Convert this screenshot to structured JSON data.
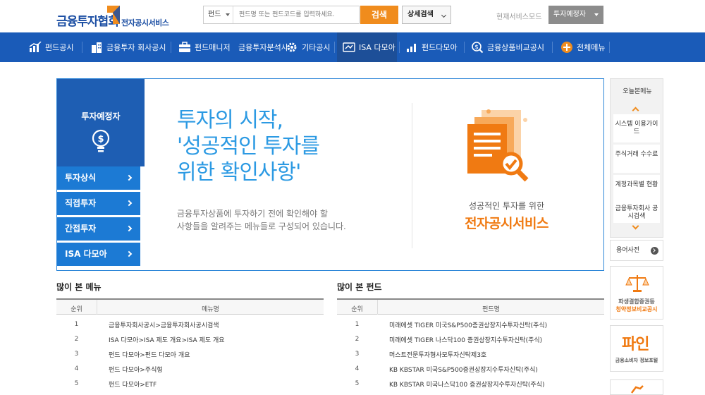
{
  "header": {
    "logo_main": "금융투자협회",
    "logo_sub": "전자공시서비스",
    "search_category": "펀드",
    "search_placeholder": "펀드명 또는 펀드코드를 입력하세요.",
    "search_button": "검색",
    "detail_search": "상세검색",
    "mode_label": "현재서비스모드",
    "mode_value": "투자예정자"
  },
  "nav": {
    "items": [
      {
        "label": "펀드공시",
        "icon": "bar-chart-icon"
      },
      {
        "label": "금융투자 회사공시",
        "icon": "buildings-icon"
      },
      {
        "label": "펀드매니저",
        "icon": "briefcase-icon"
      },
      {
        "label": "금융투자분석사",
        "icon": "analyst-icon"
      },
      {
        "label": "기타공시",
        "icon": "gear-icon"
      },
      {
        "label": "ISA 다모아",
        "icon": "isa-icon"
      },
      {
        "label": "펀드다모아",
        "icon": "growth-chart-icon"
      },
      {
        "label": "금융상품비교공시",
        "icon": "coin-search-icon"
      },
      {
        "label": "전체메뉴",
        "icon": "plus-circle-icon"
      }
    ]
  },
  "hero": {
    "side_title": "투자예정자",
    "tabs": [
      "투자상식",
      "직접투자",
      "간접투자",
      "ISA 다모아"
    ],
    "headline": [
      "투자의 시작,",
      "'성공적인 투자를",
      "위한 확인사항'"
    ],
    "desc": [
      "금융투자상품에 투자하기 전에 확인해야 할",
      "사항들을 알려주는 메뉴들로 구성되어 있습니다."
    ],
    "small": "성공적인 투자를 위한",
    "big": "전자공시서비스"
  },
  "recent": {
    "title": "오늘본메뉴",
    "items": [
      "시스템 이용가이드",
      "주식거래 수수료",
      "계정과목별 현황",
      "금융투자회사 공시검색"
    ]
  },
  "glossary": "용어사전",
  "banners": {
    "b1_line1": "파생결합증권등",
    "b1_line2": "청약정보비교공시",
    "b2_main": "파인",
    "b2_sub": "금융소비자 정보포털"
  },
  "popular_menus": {
    "title": "많이 본 메뉴",
    "col_rank": "순위",
    "col_name": "메뉴명",
    "rows": [
      {
        "rank": "1",
        "name": "금융투자회사공시>금융투자회사공시검색"
      },
      {
        "rank": "2",
        "name": "ISA 다모아>ISA 제도 개요>ISA 제도 개요"
      },
      {
        "rank": "3",
        "name": "펀드 다모아>펀드 다모아 개요"
      },
      {
        "rank": "4",
        "name": "펀드 다모아>주식형"
      },
      {
        "rank": "5",
        "name": "펀드 다모아>ETF"
      }
    ]
  },
  "popular_funds": {
    "title": "많이 본 펀드",
    "col_rank": "순위",
    "col_name": "펀드명",
    "rows": [
      {
        "rank": "1",
        "name": "미래에셋 TIGER 미국S&P500증권상장지수투자신탁(주식)"
      },
      {
        "rank": "2",
        "name": "미래에셋 TIGER 나스닥100 증권상장지수투자신탁(주식)"
      },
      {
        "rank": "3",
        "name": "머스트전문투자형사모투자신탁제3호"
      },
      {
        "rank": "4",
        "name": "KB KBSTAR 미국S&P500증권상장지수투자신탁(주식)"
      },
      {
        "rank": "5",
        "name": "KB KBSTAR 미국나스닥100 증권상장지수투자신탁(주식)"
      }
    ]
  },
  "colors": {
    "brand_blue": "#1a5bb8",
    "accent_orange": "#f08c1d",
    "headline_blue": "#2c9ae3",
    "tab_blue": "#1c7ad4"
  }
}
